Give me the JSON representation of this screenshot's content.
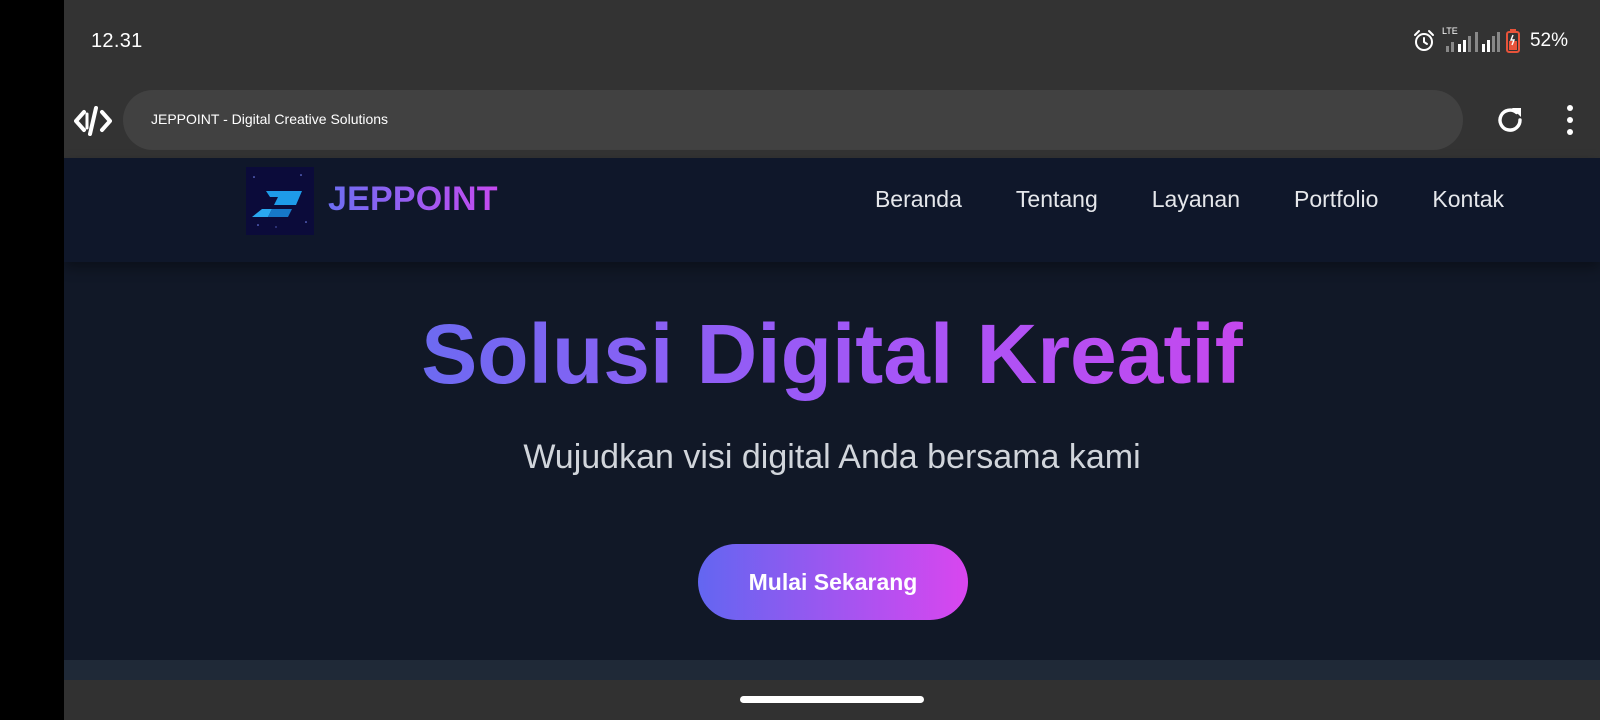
{
  "status_bar": {
    "time": "12.31",
    "network_label": "LTE",
    "battery": "52%",
    "icons": [
      "alarm-icon",
      "signal-icon",
      "battery-icon"
    ]
  },
  "browser": {
    "url_text": "JEPPOINT - Digital Creative Solutions",
    "icons": [
      "site-code-icon",
      "reload-icon",
      "overflow-menu-icon"
    ]
  },
  "site": {
    "brand": "JEPPOINT",
    "nav": [
      "Beranda",
      "Tentang",
      "Layanan",
      "Portfolio",
      "Kontak"
    ],
    "hero_title": "Solusi Digital Kreatif",
    "hero_subtitle": "Wujudkan visi digital Anda bersama kami",
    "cta_label": "Mulai Sekarang"
  },
  "colors": {
    "accent_start": "#6366f1",
    "accent_end": "#d946ef",
    "site_bg": "#111827",
    "nav_bg": "#0f172a"
  }
}
